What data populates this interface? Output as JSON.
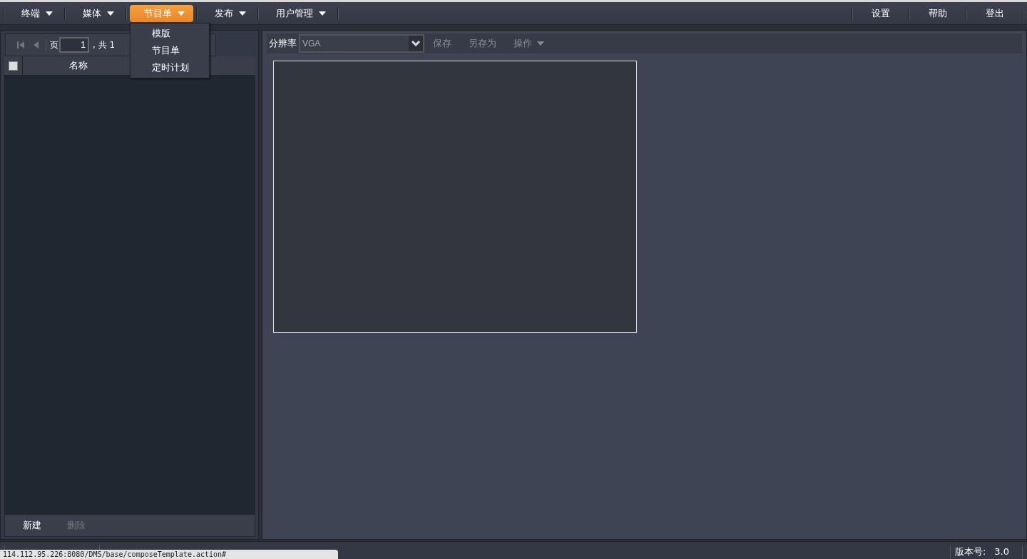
{
  "menu": [
    {
      "label": "终端",
      "selected": false
    },
    {
      "label": "媒体",
      "selected": false
    },
    {
      "label": "节目单",
      "selected": true
    },
    {
      "label": "发布",
      "selected": false
    },
    {
      "label": "用户管理",
      "selected": false
    }
  ],
  "right_menu": [
    "设置",
    "帮助",
    "登出"
  ],
  "dropdown": [
    "模版",
    "节目单",
    "定时计划"
  ],
  "pager": {
    "page_label": "页",
    "page_value": "1",
    "total": ", 共 1"
  },
  "list": {
    "select_all": false,
    "column": "名称"
  },
  "list_actions": [
    {
      "label": "新建",
      "disabled": false
    },
    {
      "label": "删除",
      "disabled": true
    }
  ],
  "editor_toolbar": {
    "resolution_label": "分辨率",
    "resolution_value": "VGA",
    "actions": [
      {
        "label": "保存",
        "disabled": true,
        "caret": false
      },
      {
        "label": "另存为",
        "disabled": true,
        "caret": false
      },
      {
        "label": "操作",
        "disabled": true,
        "caret": true
      }
    ]
  },
  "status_bar": {
    "version_label": "版本号:",
    "version": "3.0"
  },
  "browser_status": "114.112.95.226:8080/DMS/base/composeTemplate.action#"
}
